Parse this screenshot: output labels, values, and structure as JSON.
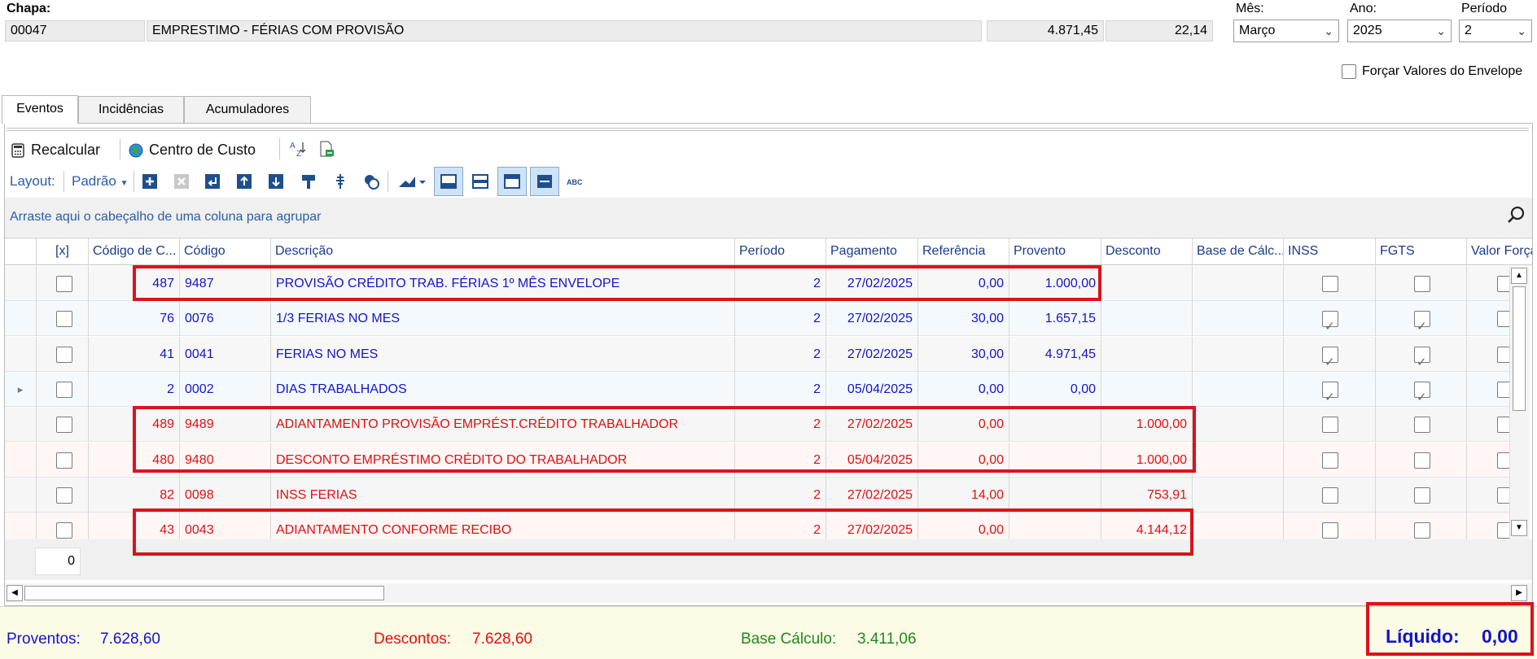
{
  "header": {
    "chapa_label": "Chapa:",
    "chapa_code": "00047",
    "chapa_desc": "EMPRESTIMO - FÉRIAS COM PROVISÃO",
    "value1": "4.871,45",
    "value2": "22,14",
    "mes_label": "Mês:",
    "mes_value": "Março",
    "ano_label": "Ano:",
    "ano_value": "2025",
    "periodo_label": "Período",
    "periodo_value": "2",
    "forcar_label": "Forçar Valores do Envelope"
  },
  "tabs": [
    {
      "label": "Eventos",
      "active": true
    },
    {
      "label": "Incidências",
      "active": false
    },
    {
      "label": "Acumuladores",
      "active": false
    }
  ],
  "toolbar": {
    "recalcular": "Recalcular",
    "centro_custo": "Centro de Custo",
    "layout_label": "Layout:",
    "layout_value": "Padrão"
  },
  "group_hint": "Arraste aqui o cabeçalho de uma coluna para agrupar",
  "grid": {
    "columns": [
      "[x]",
      "Código de C...",
      "Código",
      "Descrição",
      "Período",
      "Pagamento",
      "Referência",
      "Provento",
      "Desconto",
      "Base de Cálc...",
      "INSS",
      "FGTS",
      "Valor Força"
    ],
    "rows": [
      {
        "cc": "487",
        "codigo": "9487",
        "descricao": "PROVISÃO CRÉDITO TRAB. FÉRIAS 1º MÊS ENVELOPE",
        "periodo": "2",
        "pagamento": "27/02/2025",
        "referencia": "0,00",
        "provento": "1.000,00",
        "desconto": "",
        "inss": false,
        "fgts": false,
        "type": "provento"
      },
      {
        "cc": "76",
        "codigo": "0076",
        "descricao": "1/3 FERIAS NO MES",
        "periodo": "2",
        "pagamento": "27/02/2025",
        "referencia": "30,00",
        "provento": "1.657,15",
        "desconto": "",
        "inss": true,
        "fgts": true,
        "type": "provento"
      },
      {
        "cc": "41",
        "codigo": "0041",
        "descricao": "FERIAS NO MES",
        "periodo": "2",
        "pagamento": "27/02/2025",
        "referencia": "30,00",
        "provento": "4.971,45",
        "desconto": "",
        "inss": true,
        "fgts": true,
        "type": "provento"
      },
      {
        "cc": "2",
        "codigo": "0002",
        "descricao": "DIAS TRABALHADOS",
        "periodo": "2",
        "pagamento": "05/04/2025",
        "referencia": "0,00",
        "provento": "0,00",
        "desconto": "",
        "inss": true,
        "fgts": true,
        "type": "provento"
      },
      {
        "cc": "489",
        "codigo": "9489",
        "descricao": "ADIANTAMENTO PROVISÃO EMPRÉST.CRÉDITO TRABALHADOR",
        "periodo": "2",
        "pagamento": "27/02/2025",
        "referencia": "0,00",
        "provento": "",
        "desconto": "1.000,00",
        "inss": false,
        "fgts": false,
        "type": "desconto"
      },
      {
        "cc": "480",
        "codigo": "9480",
        "descricao": "DESCONTO EMPRÉSTIMO CRÉDITO DO TRABALHADOR",
        "periodo": "2",
        "pagamento": "05/04/2025",
        "referencia": "0,00",
        "provento": "",
        "desconto": "1.000,00",
        "inss": false,
        "fgts": false,
        "type": "desconto"
      },
      {
        "cc": "82",
        "codigo": "0098",
        "descricao": "INSS FERIAS",
        "periodo": "2",
        "pagamento": "27/02/2025",
        "referencia": "14,00",
        "provento": "",
        "desconto": "753,91",
        "inss": false,
        "fgts": false,
        "type": "desconto"
      },
      {
        "cc": "43",
        "codigo": "0043",
        "descricao": "ADIANTAMENTO CONFORME RECIBO",
        "periodo": "2",
        "pagamento": "27/02/2025",
        "referencia": "0,00",
        "provento": "",
        "desconto": "4.144,12",
        "inss": false,
        "fgts": false,
        "type": "desconto"
      }
    ],
    "count": "0"
  },
  "footer": {
    "proventos_label": "Proventos:",
    "proventos_value": "7.628,60",
    "descontos_label": "Descontos:",
    "descontos_value": "7.628,60",
    "base_label": "Base Cálculo:",
    "base_value": "3.411,06",
    "liquido_label": "Líquido:",
    "liquido_value": "0,00"
  },
  "colors": {
    "provento_text": "#1414c8",
    "desconto_text": "#e01010",
    "highlight_box": "#d9141c",
    "base_text": "#1f8a1f"
  }
}
